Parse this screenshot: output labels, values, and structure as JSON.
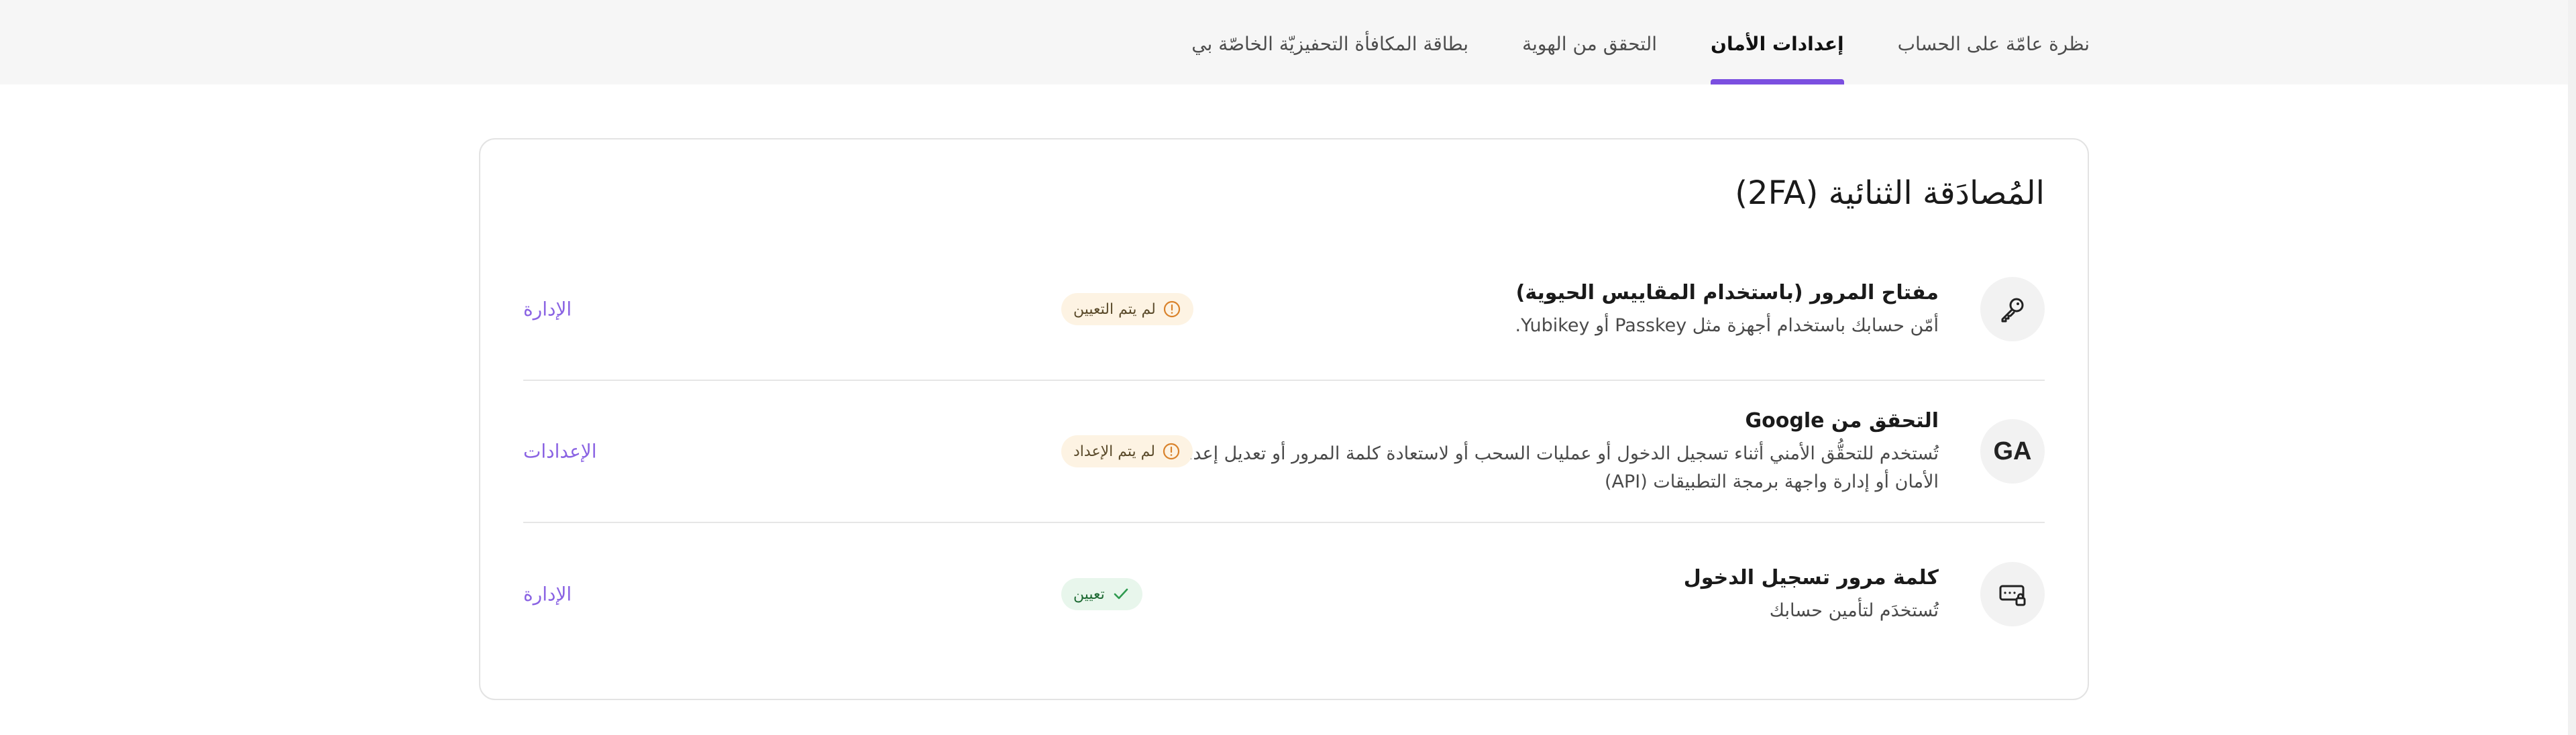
{
  "tabs": [
    {
      "label": "نظرة عامّة على الحساب",
      "active": false
    },
    {
      "label": "إعدادات الأمان",
      "active": true
    },
    {
      "label": "التحقق من الهوية",
      "active": false
    },
    {
      "label": "بطاقة المكافأة التحفيزيّة الخاصّة بي",
      "active": false
    }
  ],
  "card": {
    "title": "المُصادَقة الثنائية (2FA)",
    "rows": [
      {
        "icon": "key-icon",
        "title": "مفتاح المرور (باستخدام المقاييس الحيوية)",
        "description": "أمّن حسابك باستخدام أجهزة مثل Passkey أو Yubikey.",
        "status": "لم يتم التعيين",
        "status_type": "pending",
        "action": "الإدارة"
      },
      {
        "icon": "google-authenticator-icon",
        "icon_text": "GA",
        "title": "التحقق من Google",
        "description": "تُستخدم للتحقُّق الأمني أثناء تسجيل الدخول أو عمليات السحب أو لاستعادة كلمة المرور أو تعديل إعدادات الأمان أو إدارة واجهة برمجة التطبيقات (API)",
        "status": "لم يتم الإعداد",
        "status_type": "pending",
        "action": "الإعدادات"
      },
      {
        "icon": "password-keyboard-icon",
        "title": "كلمة مرور تسجيل الدخول",
        "description": "تُستخدَم لتأمين حسابك",
        "status": "تعيين",
        "status_type": "done",
        "action": "الإدارة"
      }
    ]
  },
  "colors": {
    "accent": "#7b4fe0",
    "link": "#8a63e3",
    "pending_bg": "#fdf3e3",
    "pending_icon": "#d9822b",
    "done_bg": "#e8f6ec",
    "done_icon": "#2e9a4f"
  }
}
